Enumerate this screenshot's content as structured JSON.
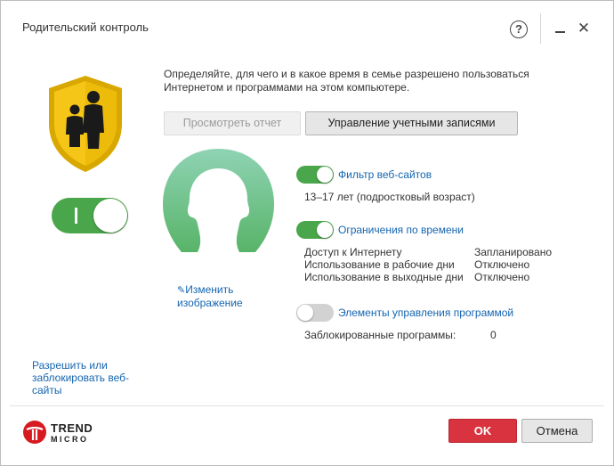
{
  "window": {
    "title": "Родительский контроль",
    "help_label": "?",
    "close_label": "✕"
  },
  "description": "Определяйте, для чего и в какое время в семье разрешено пользоваться Интернетом и программами на этом компьютере.",
  "buttons": {
    "view_report": "Просмотреть отчет",
    "manage_accounts": "Управление учетными записями",
    "ok": "OK",
    "cancel": "Отмена"
  },
  "main_toggle": {
    "state": "on",
    "label": "I"
  },
  "left_link": "Разрешить или заблокировать веб-сайты",
  "change_image": "Изменить изображение",
  "features": {
    "web_filter": {
      "label": "Фильтр веб-сайтов",
      "enabled": true,
      "detail": "13–17 лет (подростковый возраст)"
    },
    "time_limits": {
      "label": "Ограничения по времени",
      "enabled": true,
      "rows": [
        {
          "name": "Доступ к Интернету",
          "value": "Запланировано"
        },
        {
          "name": "Использование в рабочие дни",
          "value": "Отключено"
        },
        {
          "name": "Использование в выходные дни",
          "value": "Отключено"
        }
      ]
    },
    "program_controls": {
      "label": "Элементы управления программой",
      "enabled": false,
      "blocked_label": "Заблокированные программы:",
      "blocked_count": "0"
    }
  },
  "logo": {
    "brand": "TREND",
    "sub": "MICRO"
  },
  "colors": {
    "accent_green": "#4aa64a",
    "link_blue": "#1565b0",
    "ok_red": "#d9333f",
    "shield_yellow": "#f5c518"
  },
  "icons": [
    "help-icon",
    "minimize-icon",
    "close-icon",
    "family-shield-icon",
    "avatar-silhouette-icon",
    "pencil-icon",
    "trend-micro-logo-icon"
  ]
}
